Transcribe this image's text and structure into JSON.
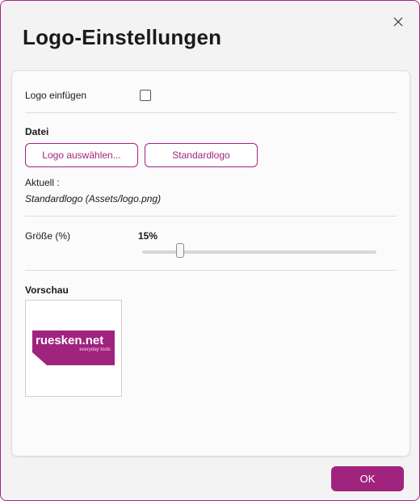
{
  "dialog": {
    "title": "Logo-Einstellungen",
    "close_icon": "close-icon"
  },
  "logo_section": {
    "insert_label": "Logo einfügen",
    "insert_checked": false
  },
  "file_section": {
    "heading": "Datei",
    "choose_button": "Logo auswählen...",
    "default_button": "Standardlogo",
    "current_label": "Aktuell :",
    "current_value": "Standardlogo (Assets/logo.png)"
  },
  "size_section": {
    "label": "Größe (%)",
    "value_text": "15%",
    "slider_value_percent": 15
  },
  "preview_section": {
    "heading": "Vorschau",
    "logo_text": "ruesken.net",
    "logo_tagline": "everyday tools"
  },
  "footer": {
    "ok_button": "OK"
  },
  "colors": {
    "accent": "#a0237e",
    "logo_bg": "#a0237e"
  }
}
